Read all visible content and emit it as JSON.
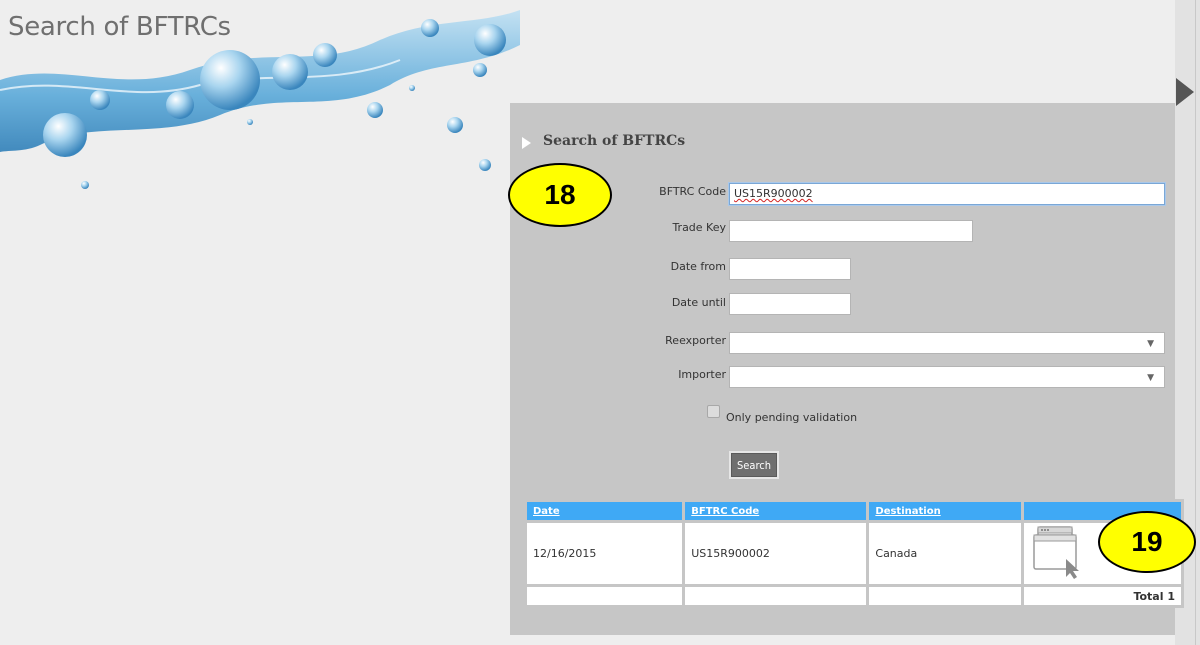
{
  "page": {
    "title": "Search of BFTRCs"
  },
  "panel": {
    "title": "Search of BFTRCs"
  },
  "form": {
    "bftrc_code": {
      "label": "BFTRC Code",
      "value": "US15R900002"
    },
    "trade_key": {
      "label": "Trade Key",
      "value": ""
    },
    "date_from": {
      "label": "Date from",
      "value": ""
    },
    "date_until": {
      "label": "Date until",
      "value": ""
    },
    "reexporter": {
      "label": "Reexporter",
      "value": ""
    },
    "importer": {
      "label": "Importer",
      "value": ""
    },
    "pending": {
      "label": "Only pending validation",
      "checked": false
    },
    "search_label": "Search"
  },
  "results": {
    "columns": [
      "Date",
      "BFTRC Code",
      "Destination",
      ""
    ],
    "rows": [
      {
        "date": "12/16/2015",
        "code": "US15R900002",
        "destination": "Canada",
        "action_icon": "open-window-icon"
      }
    ],
    "total_label": "Total 1"
  },
  "callouts": [
    "18",
    "19"
  ],
  "colors": {
    "header_blue": "#3fa9f5",
    "panel_gray": "#c6c6c6",
    "background": "#eeeeee",
    "callout_yellow": "#ffff00",
    "button_gray": "#6f6f6f"
  }
}
